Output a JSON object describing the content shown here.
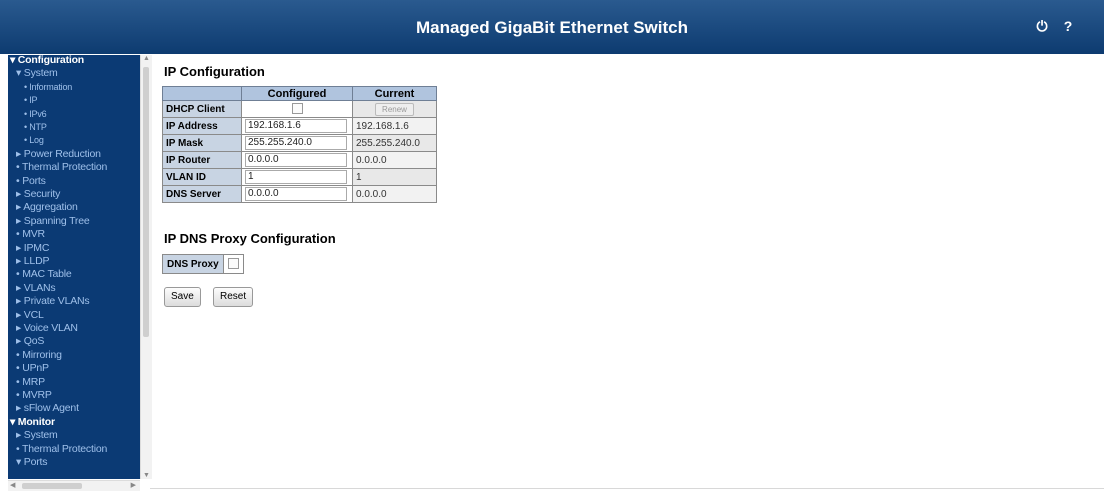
{
  "header": {
    "title": "Managed GigaBit Ethernet Switch",
    "logout_icon": "logout-icon",
    "help_icon": "help-icon"
  },
  "sidebar": {
    "items": [
      {
        "label": "▾ Configuration",
        "bold": true,
        "indent": 0
      },
      {
        "label": "▾ System",
        "indent": 1
      },
      {
        "label": "• Information",
        "indent": 2,
        "tiny": true
      },
      {
        "label": "• IP",
        "indent": 2,
        "tiny": true
      },
      {
        "label": "• IPv6",
        "indent": 2,
        "tiny": true
      },
      {
        "label": "• NTP",
        "indent": 2,
        "tiny": true
      },
      {
        "label": "• Log",
        "indent": 2,
        "tiny": true
      },
      {
        "label": "▸ Power Reduction",
        "indent": 1
      },
      {
        "label": "• Thermal Protection",
        "indent": 1
      },
      {
        "label": "• Ports",
        "indent": 1
      },
      {
        "label": "▸ Security",
        "indent": 1
      },
      {
        "label": "▸ Aggregation",
        "indent": 1
      },
      {
        "label": "▸ Spanning Tree",
        "indent": 1
      },
      {
        "label": "• MVR",
        "indent": 1
      },
      {
        "label": "▸ IPMC",
        "indent": 1
      },
      {
        "label": "▸ LLDP",
        "indent": 1
      },
      {
        "label": "• MAC Table",
        "indent": 1
      },
      {
        "label": "▸ VLANs",
        "indent": 1
      },
      {
        "label": "▸ Private VLANs",
        "indent": 1
      },
      {
        "label": "▸ VCL",
        "indent": 1
      },
      {
        "label": "▸ Voice VLAN",
        "indent": 1
      },
      {
        "label": "▸ QoS",
        "indent": 1
      },
      {
        "label": "• Mirroring",
        "indent": 1
      },
      {
        "label": "• UPnP",
        "indent": 1
      },
      {
        "label": "• MRP",
        "indent": 1
      },
      {
        "label": "• MVRP",
        "indent": 1
      },
      {
        "label": "▸ sFlow Agent",
        "indent": 1
      },
      {
        "label": "▾ Monitor",
        "bold": true,
        "indent": 0
      },
      {
        "label": "▸ System",
        "indent": 1
      },
      {
        "label": "• Thermal Protection",
        "indent": 1
      },
      {
        "label": "▾ Ports",
        "indent": 1
      }
    ]
  },
  "main": {
    "title": "IP Configuration",
    "columns": [
      "Configured",
      "Current"
    ],
    "dhcp_label": "DHCP Client",
    "renew_label": "Renew",
    "rows": [
      {
        "label": "IP Address",
        "configured": "192.168.1.6",
        "current": "192.168.1.6"
      },
      {
        "label": "IP Mask",
        "configured": "255.255.240.0",
        "current": "255.255.240.0"
      },
      {
        "label": "IP Router",
        "configured": "0.0.0.0",
        "current": "0.0.0.0"
      },
      {
        "label": "VLAN ID",
        "configured": "1",
        "current": "1"
      },
      {
        "label": "DNS Server",
        "configured": "0.0.0.0",
        "current": "0.0.0.0"
      }
    ],
    "dns_title": "IP DNS Proxy Configuration",
    "dns_proxy_label": "DNS Proxy",
    "save_label": "Save",
    "reset_label": "Reset"
  }
}
